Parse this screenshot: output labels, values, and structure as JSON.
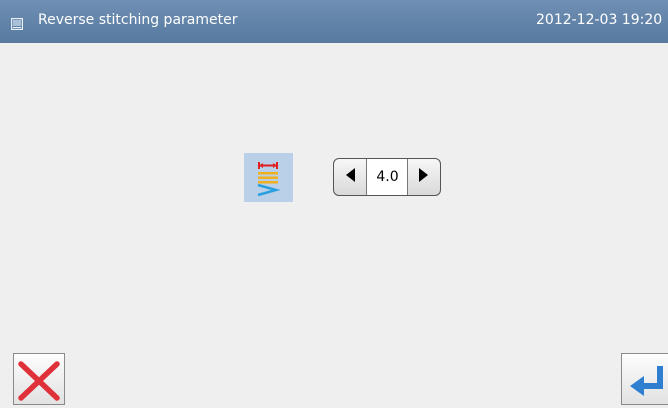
{
  "titlebar": {
    "title": "Reverse stitching parameter",
    "datetime": "2012-12-03  19:20",
    "icon": "window-icon"
  },
  "parameter": {
    "icon": "reverse-stitch-length-icon",
    "value": "4.0",
    "decrease_icon": "arrow-left-icon",
    "increase_icon": "arrow-right-icon"
  },
  "footer": {
    "cancel_icon": "cancel-x-icon",
    "enter_icon": "enter-return-icon"
  },
  "colors": {
    "titlebar": "#6381a6",
    "background": "#efefef",
    "cancel_red": "#e0303a",
    "enter_blue": "#2f7fd0",
    "icon_bg": "#b9d0e8"
  }
}
